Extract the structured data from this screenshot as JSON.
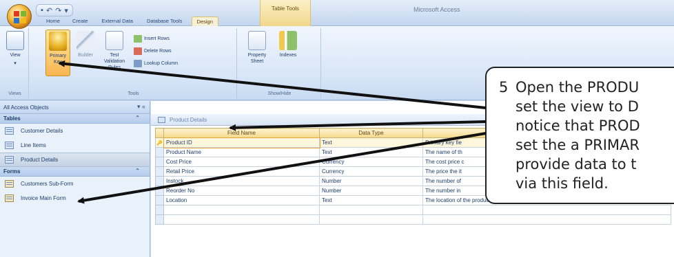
{
  "window": {
    "app_title": "Microsoft Access",
    "context_tab_group": "Table Tools"
  },
  "quick_access": {
    "items": [
      "save-icon",
      "undo-icon",
      "redo-icon",
      "customize-icon"
    ]
  },
  "ribbon_tabs": [
    {
      "label": "Home"
    },
    {
      "label": "Create"
    },
    {
      "label": "External Data"
    },
    {
      "label": "Database Tools"
    },
    {
      "label": "Design"
    }
  ],
  "ribbon": {
    "views": {
      "label": "Views",
      "view_button": "View"
    },
    "tools": {
      "label": "Tools",
      "primary_key": "Primary Key",
      "builder": "Builder",
      "test_validation": "Test Validation Rules",
      "insert_rows": "Insert Rows",
      "delete_rows": "Delete Rows",
      "lookup_column": "Lookup Column"
    },
    "show_hide": {
      "label": "Show/Hide",
      "property_sheet": "Property Sheet",
      "indexes": "Indexes"
    }
  },
  "nav_pane": {
    "header": "All Access Objects",
    "groups": [
      {
        "label": "Tables",
        "items": [
          "Customer Details",
          "Line Items",
          "Product Details"
        ],
        "selected": "Product Details"
      },
      {
        "label": "Forms",
        "items": [
          "Customers Sub-Form",
          "Invoice Main Form"
        ]
      }
    ]
  },
  "document": {
    "tab_label": "Product Details",
    "columns": [
      "Field Name",
      "Data Type",
      "Description"
    ],
    "rows": [
      {
        "field": "Product ID",
        "type": "Text",
        "description": "Primary key fie",
        "primary_key": true
      },
      {
        "field": "Product Name",
        "type": "Text",
        "description": "The name of th"
      },
      {
        "field": "Cost Price",
        "type": "Currency",
        "description": "The cost price c"
      },
      {
        "field": "Retail Price",
        "type": "Currency",
        "description": "The price the it"
      },
      {
        "field": "Instock",
        "type": "Number",
        "description": "The number of"
      },
      {
        "field": "Reorder No",
        "type": "Number",
        "description": "The number in"
      },
      {
        "field": "Location",
        "type": "Text",
        "description": "The location of the product in the building"
      }
    ]
  },
  "callout": {
    "number": "5",
    "lines": [
      "Open the PRODU",
      "set the view to D",
      "notice that PROD",
      "set the a PRIMAR",
      "provide data to t",
      "via this field."
    ]
  },
  "colors": {
    "callout_border": "#222222",
    "arrow": "#111111",
    "ribbon_active": "#f8b651"
  }
}
